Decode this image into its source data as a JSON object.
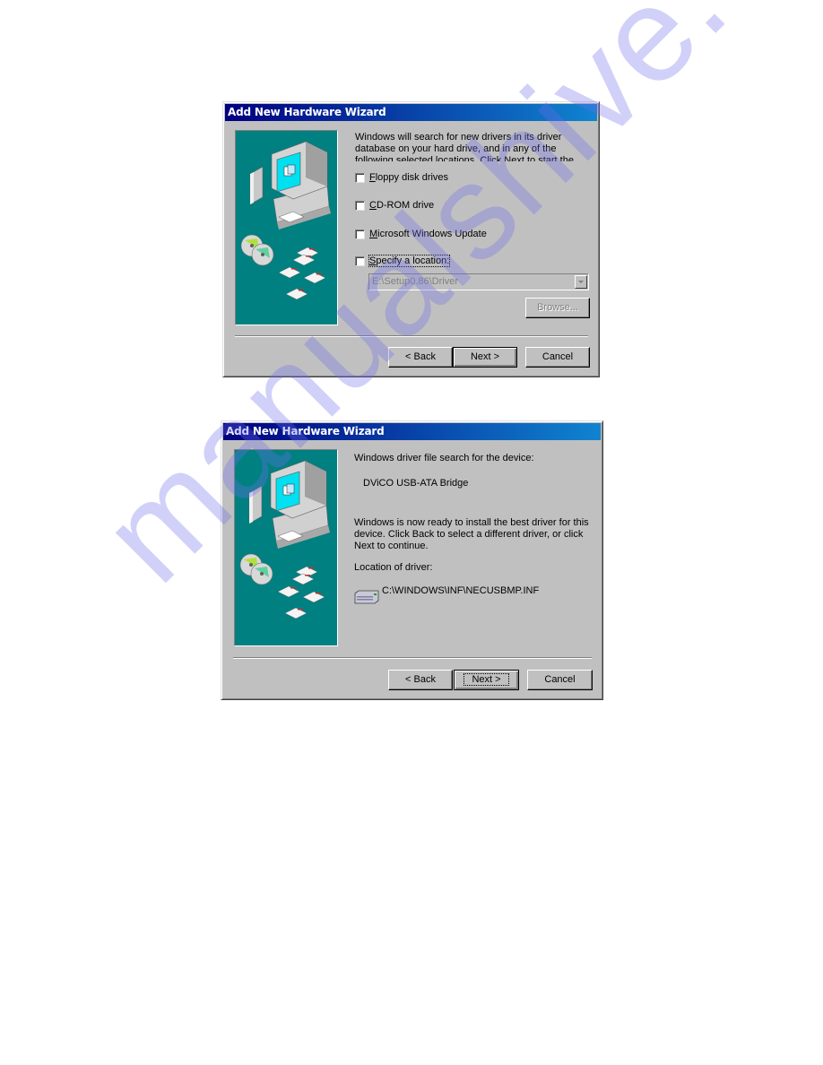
{
  "dialog1": {
    "title": "Add New Hardware Wizard",
    "intro": "Windows will search for new drivers in its driver database on your hard drive, and in any of the following selected locations. Click Next to start the search.",
    "options": [
      {
        "pre": "",
        "key": "F",
        "post": "loppy disk drives",
        "checked": false
      },
      {
        "pre": "",
        "key": "C",
        "post": "D-ROM drive",
        "checked": false
      },
      {
        "pre": "",
        "key": "M",
        "post": "icrosoft Windows Update",
        "checked": false
      },
      {
        "pre": "",
        "key": "S",
        "post": "pecify a location:",
        "checked": false
      }
    ],
    "location_value": "E:\\Setup0.86\\Driver",
    "browse_label": "Browse...",
    "back_label": "< Back",
    "next_label": "Next >",
    "cancel_label": "Cancel"
  },
  "dialog2": {
    "title": "Add New Hardware Wizard",
    "heading": "Windows driver file search for the device:",
    "device_name": "DViCO USB-ATA Bridge",
    "message": "Windows is now ready to install the best driver for this device. Click Back to select a different driver, or click Next to continue.",
    "location_label": "Location of driver:",
    "driver_path": "C:\\WINDOWS\\INF\\NECUSBMP.INF",
    "back_label": "< Back",
    "next_label": "Next >",
    "cancel_label": "Cancel"
  },
  "watermark": "manualshive.com",
  "colors": {
    "title_start": "#000080",
    "title_end": "#1084d0",
    "dialog_bg": "#c0c0c0",
    "art_bg": "#008080"
  }
}
